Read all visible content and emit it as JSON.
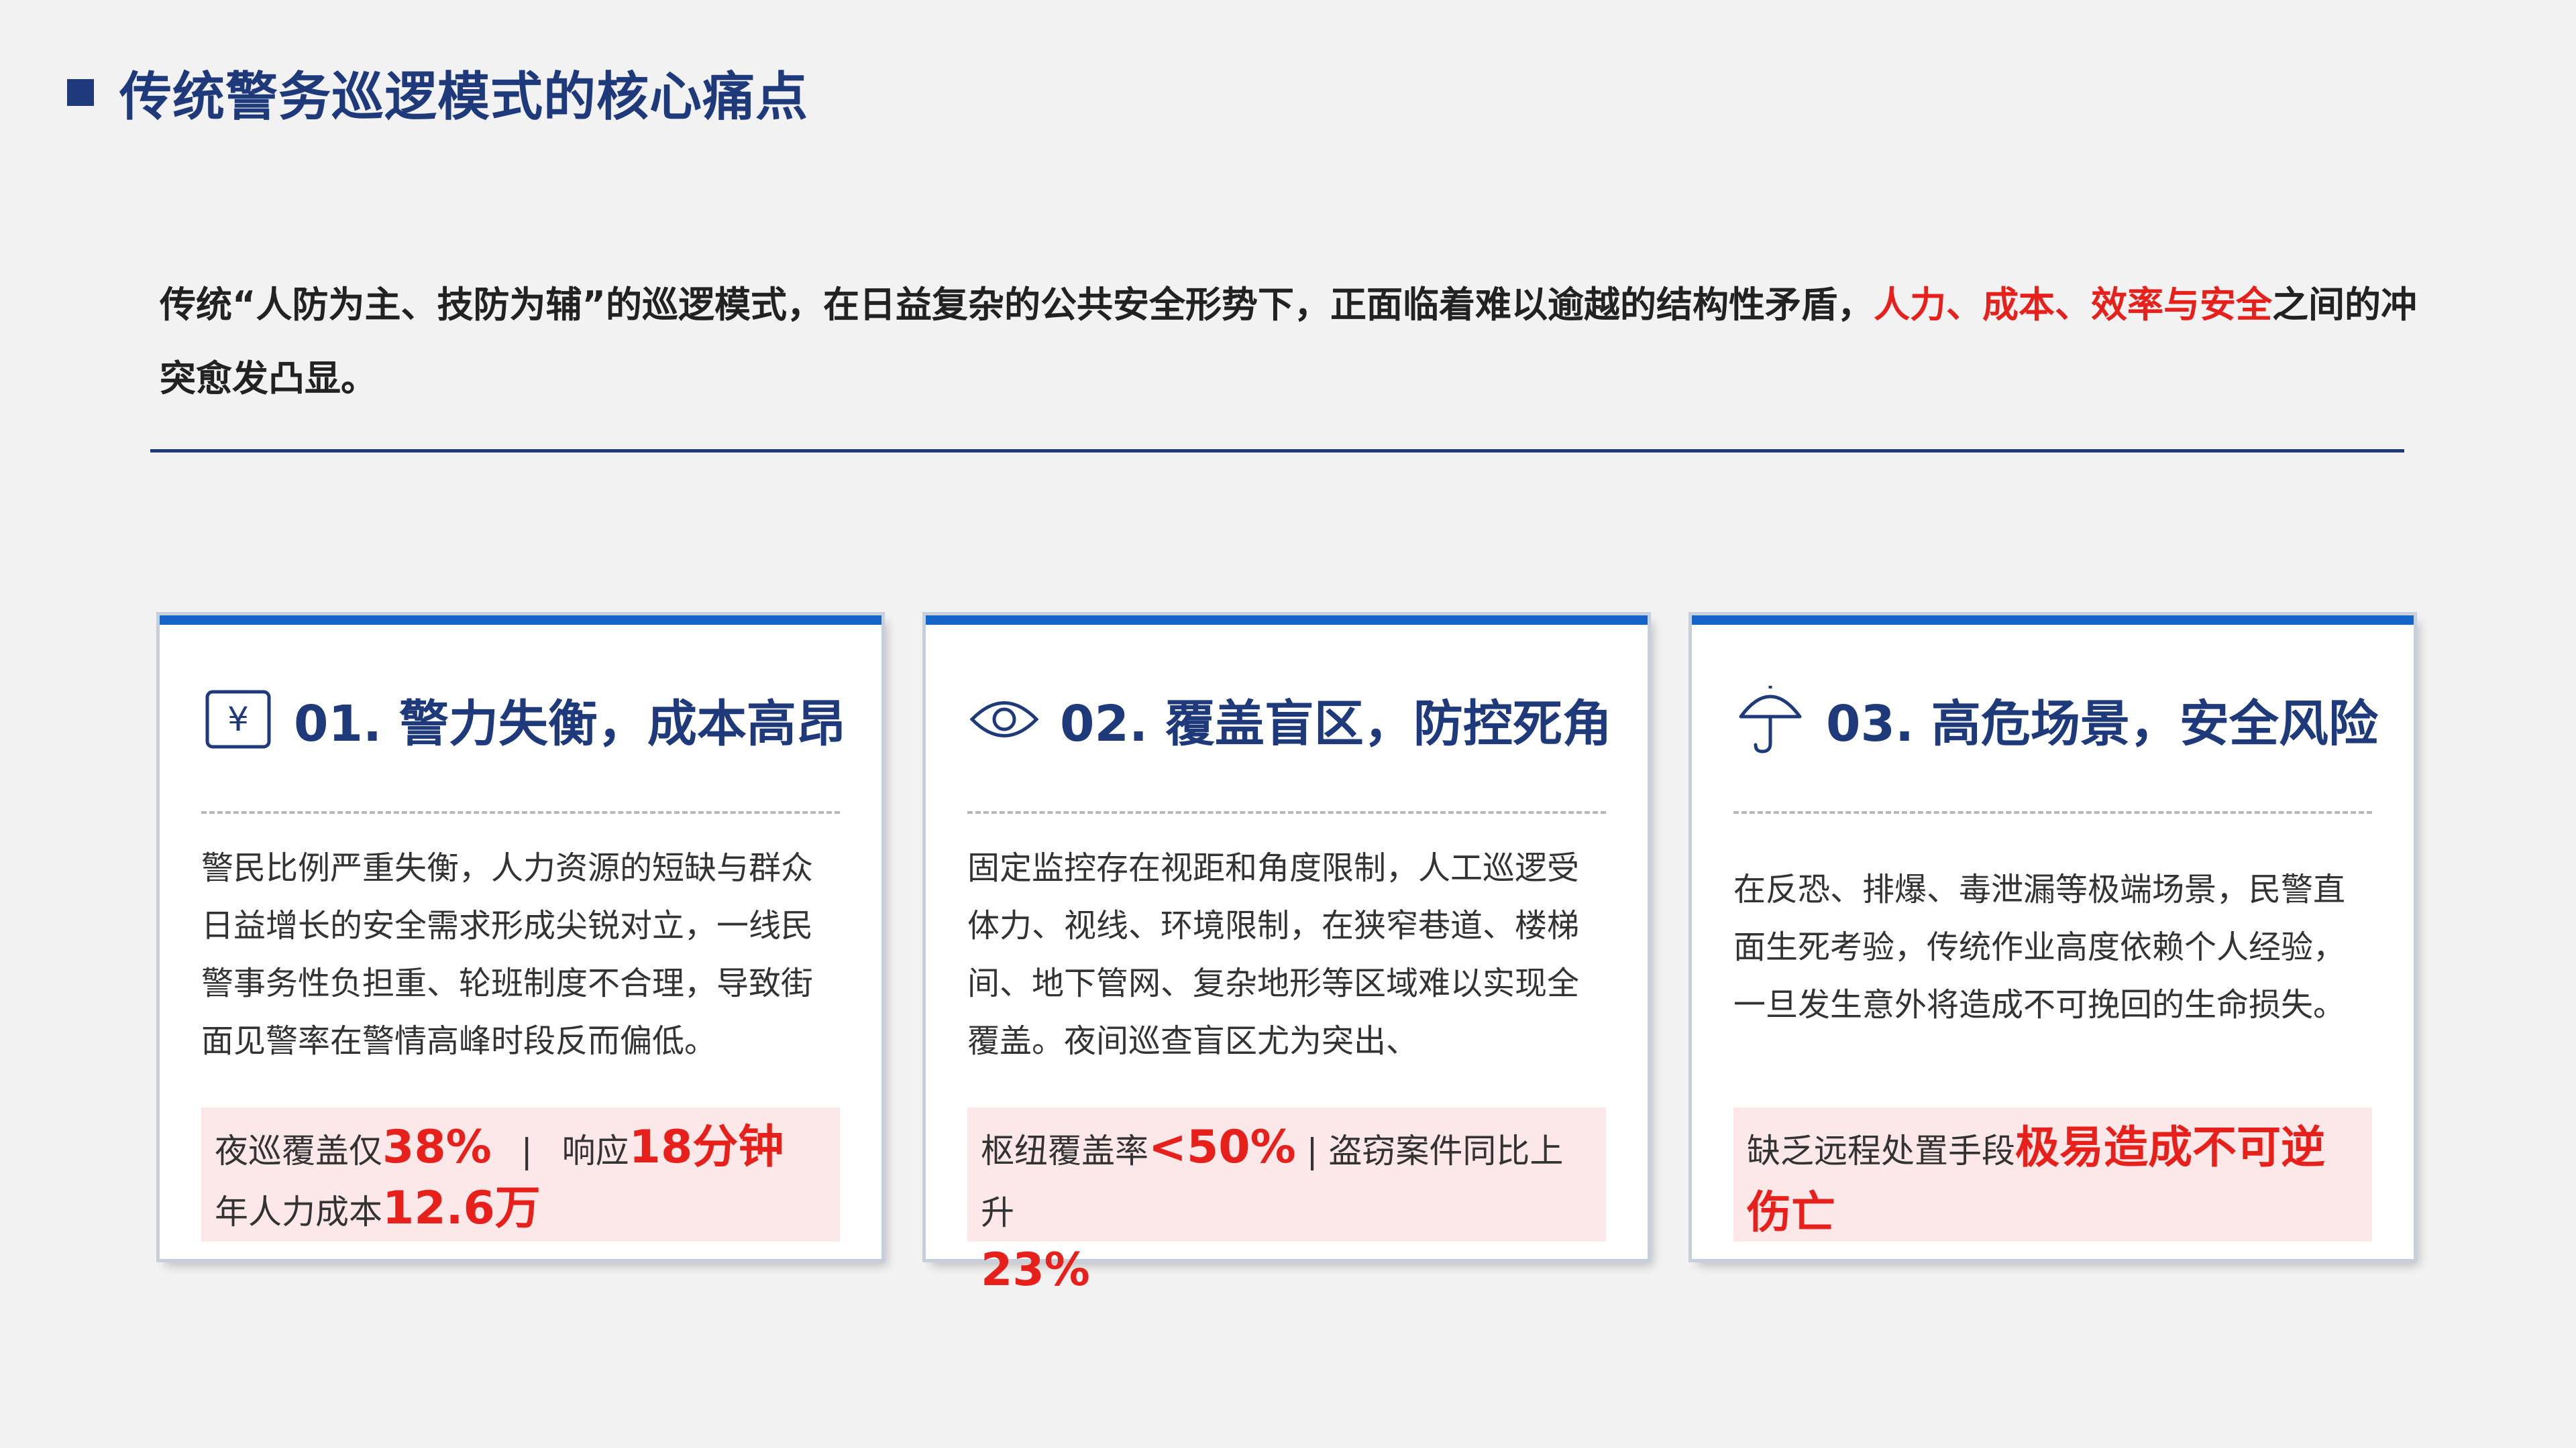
{
  "page": {
    "title": "传统警务巡逻模式的核心痛点",
    "intro_prefix": "传统“人防为主、技防为辅”的巡逻模式，在日益复杂的公共安全形势下，正面临着难以逾越的结构性矛盾，",
    "intro_highlight": "人力、成本、效率与安全",
    "intro_suffix": "之间的冲突愈发凸显。"
  },
  "colors": {
    "primary": "#1f3a7a",
    "accent_top": "#1565c8",
    "highlight": "#e8201b",
    "stat_bg": "#fce8e8"
  },
  "cards": [
    {
      "icon": "yen-icon",
      "title": "01. 警力失衡，成本高昂",
      "body": "警民比例严重失衡，人力资源的短缺与群众日益增长的安全需求形成尖锐对立，一线民警事务性负担重、轮班制度不合理，导致街面见警率在警情高峰时段反而偏低。",
      "stat_line1_a": "夜巡覆盖仅",
      "stat_line1_b": "38%",
      "stat_line1_sep": "|",
      "stat_line1_c": "响应",
      "stat_line1_d": "18分钟",
      "stat_line2_a": "年人力成本",
      "stat_line2_b": "12.6万"
    },
    {
      "icon": "eye-icon",
      "title": "02. 覆盖盲区，防控死角",
      "body": "固定监控存在视距和角度限制，人工巡逻受体力、视线、环境限制，在狭窄巷道、楼梯间、地下管网、复杂地形等区域难以实现全覆盖。夜间巡查盲区尤为突出、",
      "stat_a": "枢纽覆盖率",
      "stat_b": "<50%",
      "stat_c": " | 盗窃案件同比上升",
      "stat_d": "23%"
    },
    {
      "icon": "umbrella-icon",
      "title": "03. 高危场景，安全风险",
      "body": "在反恐、排爆、毒泄漏等极端场景，民警直面生死考验，传统作业高度依赖个人经验，一旦发生意外将造成不可挽回的生命损失。",
      "stat_a": "缺乏远程处置手段",
      "stat_b": "极易造成不可逆伤亡"
    }
  ]
}
